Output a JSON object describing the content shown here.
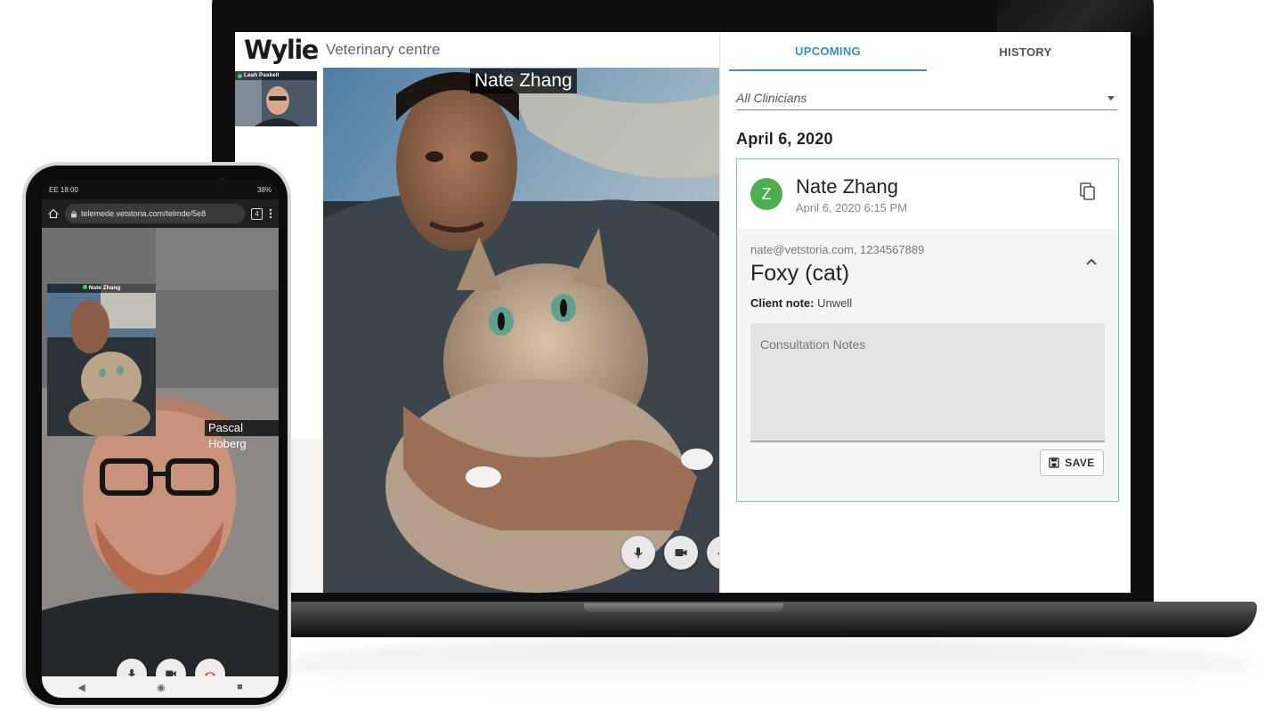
{
  "laptop": {
    "header": {
      "logo": "Wylie",
      "clinic": "Veterinary centre"
    },
    "self_view": {
      "label": "Leah Paskell"
    },
    "main_video": {
      "caller_label": "Nate Zhang"
    },
    "controls": {
      "mic": "microphone-icon",
      "camera": "camera-icon",
      "hangup": "hang-up-icon"
    },
    "panel": {
      "tabs": [
        {
          "label": "UPCOMING",
          "active": true
        },
        {
          "label": "HISTORY",
          "active": false
        }
      ],
      "clinician_filter": {
        "value": "All Clinicians"
      },
      "date_heading": "April 6, 2020",
      "appointment": {
        "avatar_initial": "Z",
        "client_name": "Nate Zhang",
        "time": "April 6, 2020 6:15 PM",
        "contact": "nate@vetstoria.com, 1234567889",
        "pet": "Foxy (cat)",
        "client_note_label": "Client note:",
        "client_note_value": " Unwell",
        "notes_placeholder": "Consultation Notes",
        "save_label": "SAVE"
      }
    }
  },
  "phone": {
    "status": {
      "left": "EE 18:00",
      "right": "38%"
    },
    "url": "telemede.vetstoria.com/telmde/5e8",
    "tab_count": "4",
    "pip_label": "Nate Zhang",
    "remote_name": "Pascal Hoberg",
    "nav": {
      "back": "◀",
      "home": "◉",
      "recents": "■"
    }
  },
  "colors": {
    "accent_blue": "#3a8fc8",
    "avatar_green": "#4cae4f",
    "card_border": "#7fcf8f",
    "hangup": "#c0533a"
  }
}
